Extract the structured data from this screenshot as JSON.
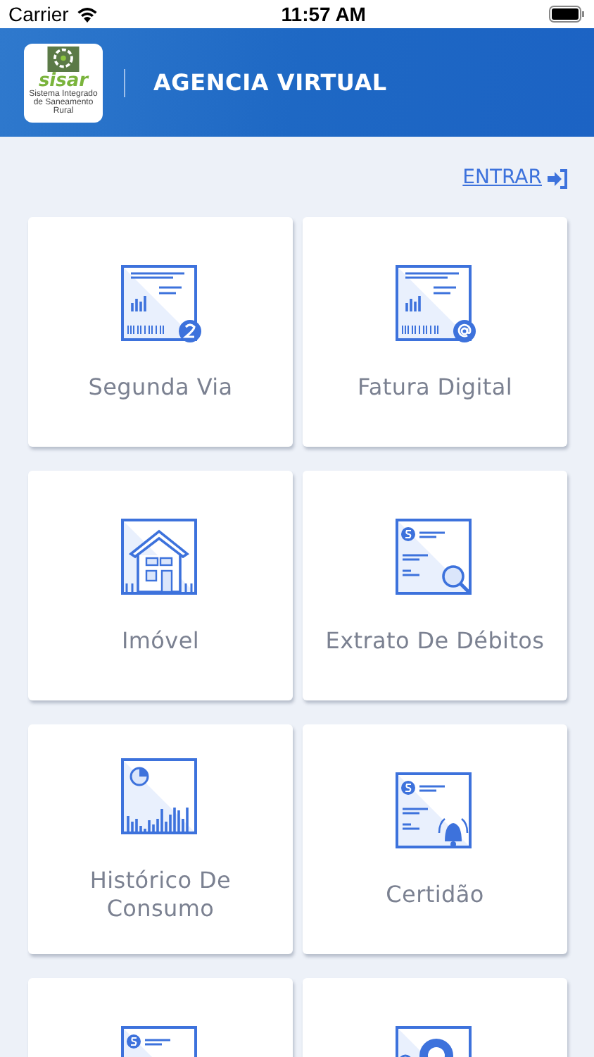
{
  "status_bar": {
    "carrier": "Carrier",
    "time": "11:57 AM"
  },
  "header": {
    "logo_word": "sisar",
    "logo_caption": "Sistema Integrado de Saneamento Rural",
    "title": "AGENCIA VIRTUAL"
  },
  "login_link": "ENTRAR",
  "tiles": [
    {
      "kind": "bill-2",
      "label": "Segunda Via"
    },
    {
      "kind": "bill-at",
      "label": "Fatura Digital"
    },
    {
      "kind": "house",
      "label": "Imóvel"
    },
    {
      "kind": "debt-search",
      "label": "Extrato De Débitos"
    },
    {
      "kind": "history",
      "label": "Histórico De Consumo"
    },
    {
      "kind": "certificate",
      "label": "Certidão"
    },
    {
      "kind": "dollar-doc"
    },
    {
      "kind": "gear-doc"
    }
  ]
}
